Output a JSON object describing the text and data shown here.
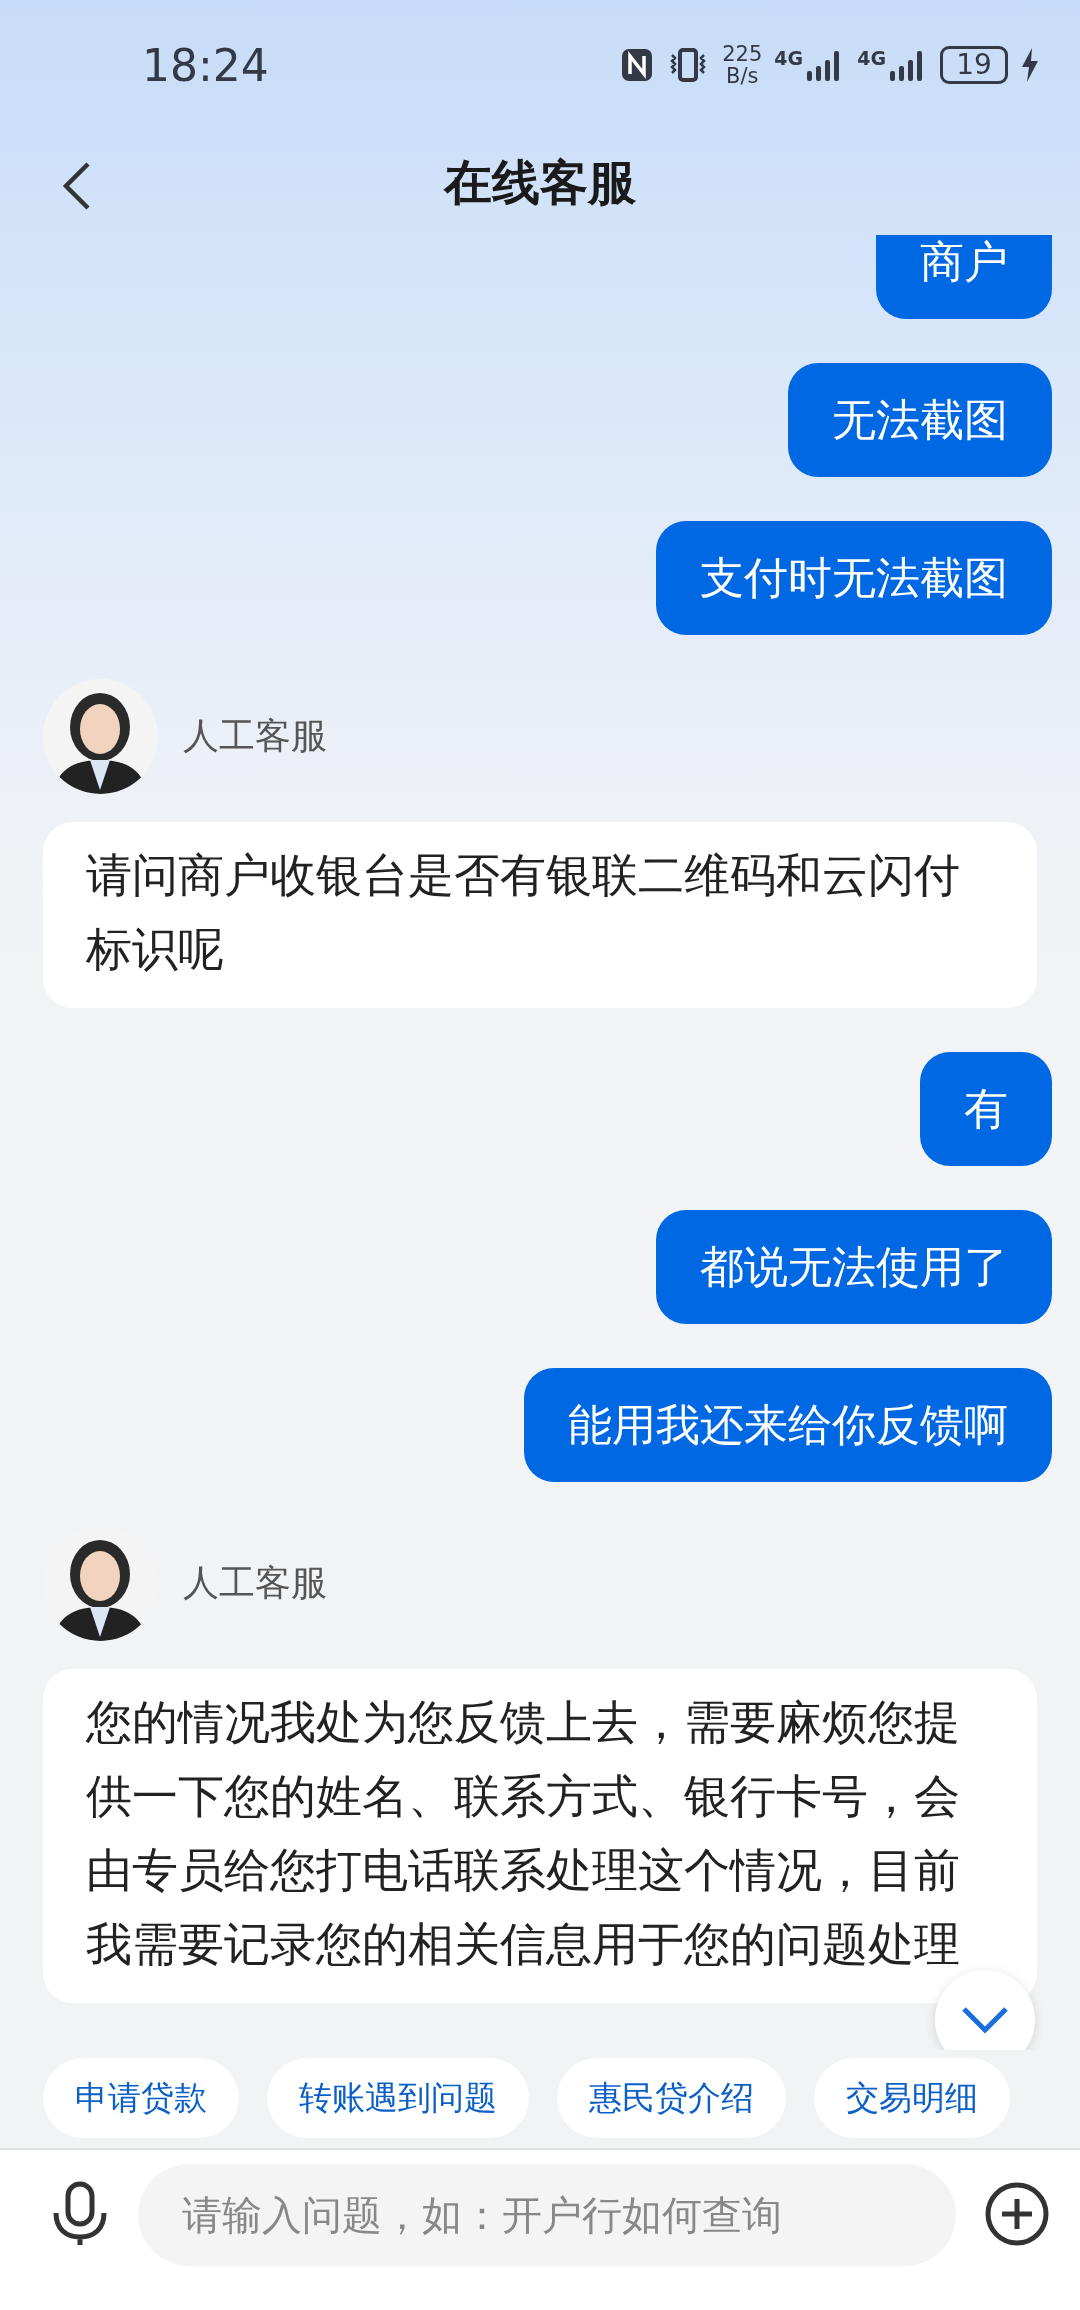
{
  "status_bar": {
    "time": "18:24",
    "speed_value": "225",
    "speed_unit": "B/s",
    "network_1": "4G",
    "network_2": "4G",
    "battery": "19"
  },
  "header": {
    "title": "在线客服"
  },
  "messages": [
    {
      "kind": "user",
      "text": "商户"
    },
    {
      "kind": "user",
      "text": "无法截图"
    },
    {
      "kind": "user",
      "text": "支付时无法截图"
    },
    {
      "kind": "agent",
      "name": "人工客服",
      "text": "请问商户收银台是否有银联二维码和云闪付标识呢"
    },
    {
      "kind": "user",
      "text": "有"
    },
    {
      "kind": "user",
      "text": "都说无法使用了"
    },
    {
      "kind": "user",
      "text": "能用我还来给你反馈啊"
    },
    {
      "kind": "agent",
      "name": "人工客服",
      "text": "您的情况我处为您反馈上去，需要麻烦您提供一下您的姓名、联系方式、银行卡号，会由专员给您打电话联系处理这个情况，目前我需要记录您的相关信息用于您的问题处理"
    }
  ],
  "quick_replies": [
    "申请贷款",
    "转账遇到问题",
    "惠民贷介绍",
    "交易明细"
  ],
  "input": {
    "placeholder": "请输入问题，如：开户行如何查询"
  }
}
